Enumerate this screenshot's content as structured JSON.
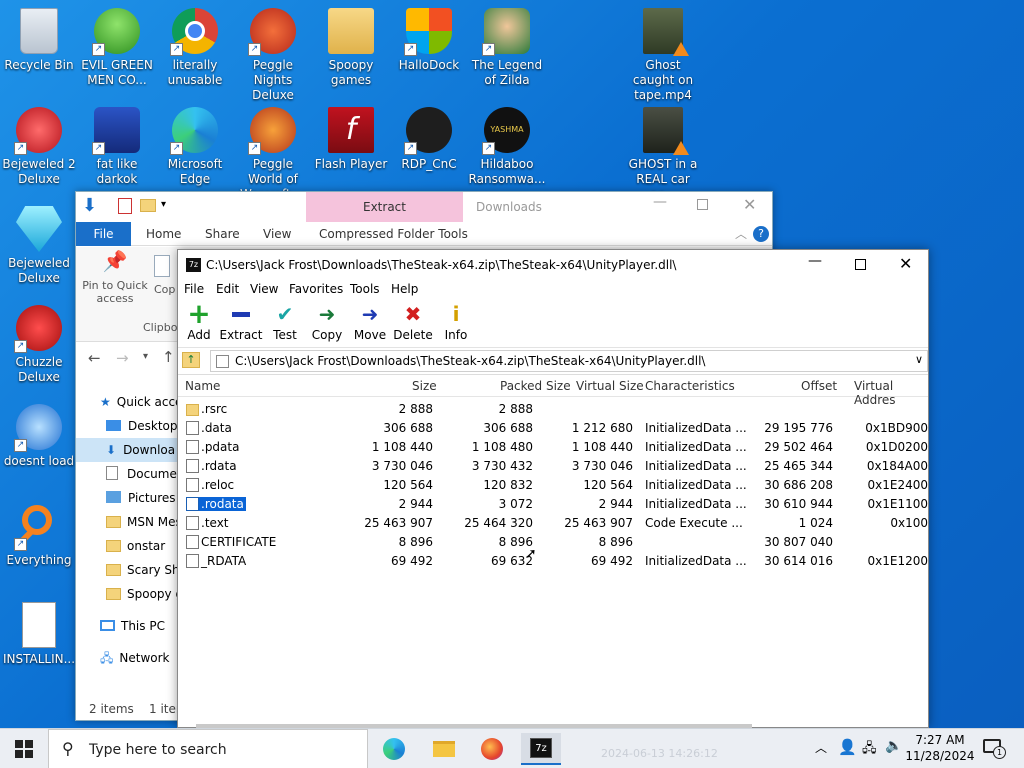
{
  "desktop": {
    "icons": [
      {
        "label": "Recycle Bin"
      },
      {
        "label": "EVIL GREEN MEN CO..."
      },
      {
        "label": "literally unusable"
      },
      {
        "label": "Peggle Nights Deluxe"
      },
      {
        "label": "Spoopy games"
      },
      {
        "label": "HalloDock"
      },
      {
        "label": "The Legend of Zilda"
      },
      {
        "label": "Ghost caught on tape.mp4"
      },
      {
        "label": "Bejeweled 2 Deluxe"
      },
      {
        "label": "fat like darkok"
      },
      {
        "label": "Microsoft Edge"
      },
      {
        "label": "Peggle World of Warcraft ..."
      },
      {
        "label": "Flash Player"
      },
      {
        "label": "RDP_CnC"
      },
      {
        "label": "Hildaboo Ransomwa..."
      },
      {
        "label": "GHOST in a REAL car ac..."
      },
      {
        "label": "Bejeweled Deluxe"
      },
      {
        "label": "Chuzzle Deluxe"
      },
      {
        "label": "doesnt load"
      },
      {
        "label": "Everything"
      },
      {
        "label": "INSTALLIN..."
      }
    ]
  },
  "explorer": {
    "title": "Downloads",
    "extract_tab": "Extract",
    "tabs": [
      "File",
      "Home",
      "Share",
      "View",
      "Compressed Folder Tools"
    ],
    "ribbon": {
      "pin": "Pin to Quick access",
      "copy": "Cop",
      "clipboard": "Clipbo"
    },
    "tree": [
      {
        "label": "Quick acce"
      },
      {
        "label": "Desktop"
      },
      {
        "label": "Downloa"
      },
      {
        "label": "Documer"
      },
      {
        "label": "Pictures"
      },
      {
        "label": "MSN Mes"
      },
      {
        "label": "onstar"
      },
      {
        "label": "Scary Shi"
      },
      {
        "label": "Spoopy g"
      },
      {
        "label": "This PC"
      },
      {
        "label": "Network"
      }
    ],
    "status_items": "2 items",
    "status_sel": "1 item"
  },
  "sevenzip": {
    "title": "C:\\Users\\Jack Frost\\Downloads\\TheSteak-x64.zip\\TheSteak-x64\\UnityPlayer.dll\\",
    "menu": [
      "File",
      "Edit",
      "View",
      "Favorites",
      "Tools",
      "Help"
    ],
    "toolbar": [
      "Add",
      "Extract",
      "Test",
      "Copy",
      "Move",
      "Delete",
      "Info"
    ],
    "address": "C:\\Users\\Jack Frost\\Downloads\\TheSteak-x64.zip\\TheSteak-x64\\UnityPlayer.dll\\",
    "columns": [
      "Name",
      "Size",
      "Packed Size",
      "Virtual Size",
      "Characteristics",
      "Offset",
      "Virtual Addres"
    ],
    "rows": [
      {
        "name": ".rsrc",
        "size": "2 888",
        "packed": "2 888",
        "vsize": "",
        "chars": "",
        "offset": "",
        "vaddr": ""
      },
      {
        "name": ".data",
        "size": "306 688",
        "packed": "306 688",
        "vsize": "1 212 680",
        "chars": "InitializedData ...",
        "offset": "29 195 776",
        "vaddr": "0x1BD900"
      },
      {
        "name": ".pdata",
        "size": "1 108 440",
        "packed": "1 108 480",
        "vsize": "1 108 440",
        "chars": "InitializedData ...",
        "offset": "29 502 464",
        "vaddr": "0x1D0200"
      },
      {
        "name": ".rdata",
        "size": "3 730 046",
        "packed": "3 730 432",
        "vsize": "3 730 046",
        "chars": "InitializedData ...",
        "offset": "25 465 344",
        "vaddr": "0x184A00"
      },
      {
        "name": ".reloc",
        "size": "120 564",
        "packed": "120 832",
        "vsize": "120 564",
        "chars": "InitializedData ...",
        "offset": "30 686 208",
        "vaddr": "0x1E2400"
      },
      {
        "name": ".rodata",
        "size": "2 944",
        "packed": "3 072",
        "vsize": "2 944",
        "chars": "InitializedData ...",
        "offset": "30 610 944",
        "vaddr": "0x1E1100"
      },
      {
        "name": ".text",
        "size": "25 463 907",
        "packed": "25 464 320",
        "vsize": "25 463 907",
        "chars": "Code Execute ...",
        "offset": "1 024",
        "vaddr": "0x100"
      },
      {
        "name": "CERTIFICATE",
        "size": "8 896",
        "packed": "8 896",
        "vsize": "8 896",
        "chars": "",
        "offset": "30 807 040",
        "vaddr": ""
      },
      {
        "name": "_RDATA",
        "size": "69 492",
        "packed": "69 632",
        "vsize": "69 492",
        "chars": "InitializedData ...",
        "offset": "30 614 016",
        "vaddr": "0x1E1200"
      }
    ]
  },
  "taskbar": {
    "search_placeholder": "Type here to search",
    "time": "7:27 AM",
    "date": "11/28/2024",
    "notification_count": "1",
    "watermark": "2024-06-13 14:26:12"
  },
  "colors": {
    "desktop": "#0b6fd1",
    "accent": "#1a6fc9",
    "selection": "#0a64d6"
  }
}
